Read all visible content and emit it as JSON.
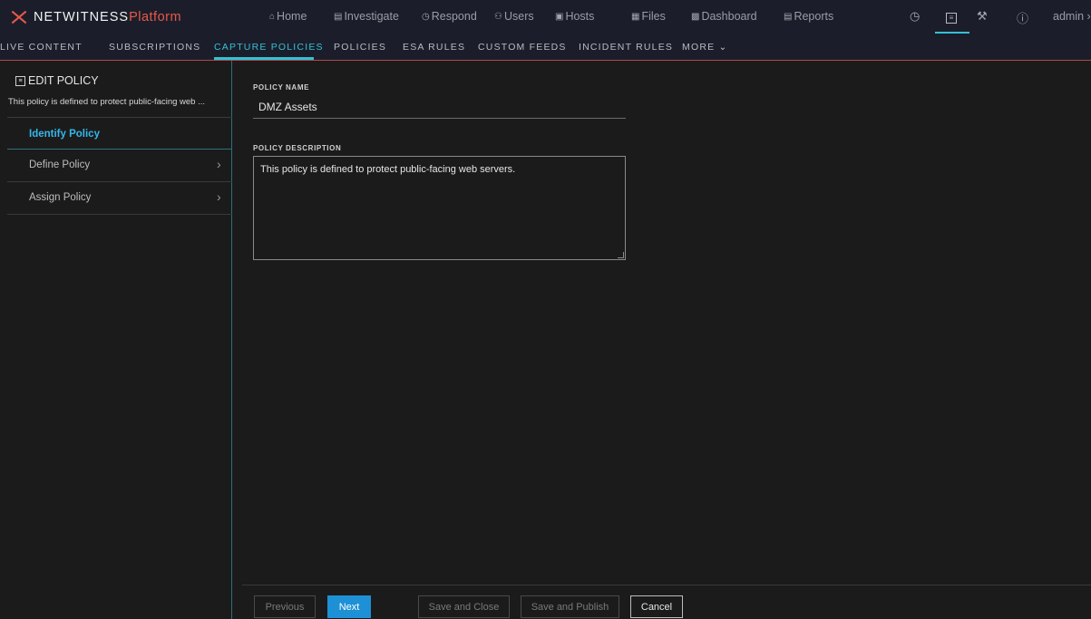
{
  "brand": {
    "name": "NETWITNESS",
    "suffix": "Platform"
  },
  "main_nav": [
    {
      "id": "home",
      "icon": "⌂",
      "label": "Home"
    },
    {
      "id": "investigate",
      "icon": "▤",
      "label": "Investigate"
    },
    {
      "id": "respond",
      "icon": "◷",
      "label": "Respond"
    },
    {
      "id": "users",
      "icon": "⚇",
      "label": "Users"
    },
    {
      "id": "hosts",
      "icon": "▣",
      "label": "Hosts"
    },
    {
      "id": "files",
      "icon": "▦",
      "label": "Files"
    },
    {
      "id": "dashboard",
      "icon": "▩",
      "label": "Dashboard"
    },
    {
      "id": "reports",
      "icon": "▤",
      "label": "Reports"
    }
  ],
  "header_right": {
    "timer_icon": "stopwatch-icon",
    "config_icon": "config-icon",
    "tools_icon": "tools-icon",
    "help_icon": "help-icon",
    "user": "admin"
  },
  "sub_nav": [
    {
      "label": "LIVE CONTENT"
    },
    {
      "label": "SUBSCRIPTIONS"
    },
    {
      "label": "CAPTURE POLICIES"
    },
    {
      "label": "POLICIES"
    },
    {
      "label": "ESA RULES"
    },
    {
      "label": "CUSTOM FEEDS"
    },
    {
      "label": "INCIDENT RULES"
    },
    {
      "label": "MORE"
    }
  ],
  "sidebar": {
    "title": "EDIT POLICY",
    "description": "This policy is defined to protect public-facing web ...",
    "steps": [
      {
        "label": "Identify Policy",
        "active": true
      },
      {
        "label": "Define Policy",
        "active": false
      },
      {
        "label": "Assign Policy",
        "active": false
      }
    ]
  },
  "form": {
    "name_label": "POLICY NAME",
    "name_value": "DMZ Assets",
    "description_label": "POLICY DESCRIPTION",
    "description_value": "This policy is defined to  protect public-facing web servers."
  },
  "footer": {
    "previous": "Previous",
    "next": "Next",
    "save_close": "Save and Close",
    "save_publish": "Save and Publish",
    "cancel": "Cancel"
  },
  "colors": {
    "accent": "#35c0d6",
    "primary_button": "#1e90d6",
    "brand_red": "#e8584a",
    "active_step": "#35b7ea"
  }
}
